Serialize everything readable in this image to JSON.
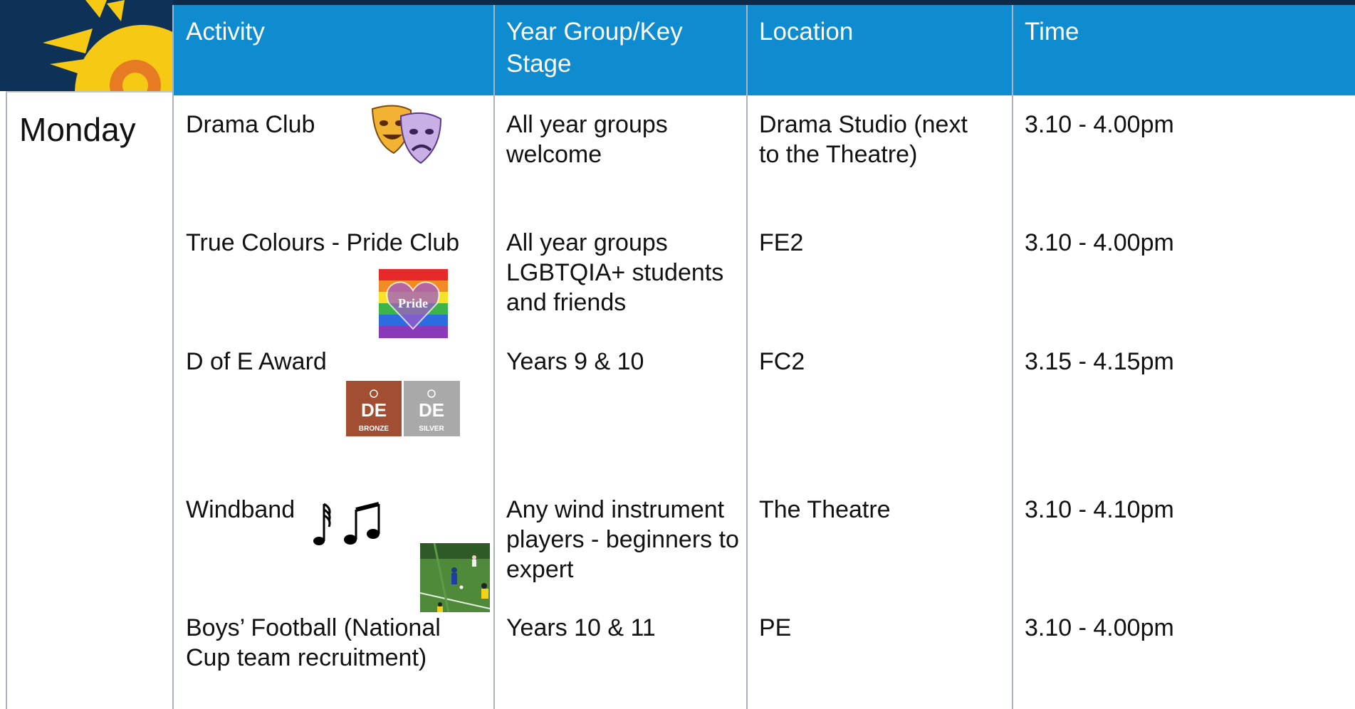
{
  "table": {
    "headers": {
      "activity": "Activity",
      "year_group": "Year Group/Key Stage",
      "location": "Location",
      "time": "Time"
    },
    "day": "Monday",
    "rows": [
      {
        "activity": "Drama Club",
        "year_group": "All year groups welcome",
        "location": "Drama Studio (next to the Theatre)",
        "time": "3.10 - 4.00pm"
      },
      {
        "activity": "True Colours - Pride Club",
        "year_group": "All year groups LGBTQIA+ students and friends",
        "location": "FE2",
        "time": "3.10 - 4.00pm"
      },
      {
        "activity": "D of E Award",
        "year_group": "Years 9 & 10",
        "location": "FC2",
        "time": "3.15 - 4.15pm"
      },
      {
        "activity": "Windband",
        "year_group": "Any wind instrument players - beginners to expert",
        "location": "The Theatre",
        "time": "3.10 - 4.10pm"
      },
      {
        "activity": "Boys’ Football (National Cup team recruitment)",
        "year_group": "Years 10 & 11",
        "location": "PE",
        "time": "3.10 - 4.00pm"
      }
    ]
  },
  "images": {
    "pride_text": "Pride",
    "doe_logo_text": "DE",
    "doe_bronze": "BRONZE",
    "doe_silver": "SILVER",
    "icons": [
      "school-sun-logo",
      "theatre-masks-icon",
      "pride-heart-image",
      "doe-award-badges",
      "music-notes-icon",
      "football-photo"
    ]
  },
  "colors": {
    "header_bg": "#0f8bd0",
    "header_text": "#ffffff",
    "logo_bg": "#0e3257",
    "sun": "#f6c915",
    "bronze": "#a24e32",
    "silver": "#a9a9a9"
  }
}
